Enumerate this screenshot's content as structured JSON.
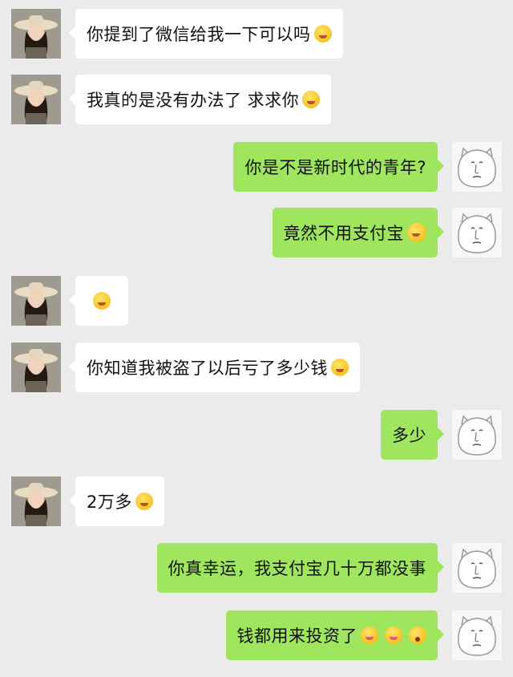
{
  "messages": [
    {
      "side": "left",
      "text": "你提到了微信给我一下可以吗",
      "emoji": "grimace-emoji"
    },
    {
      "side": "left",
      "text": "我真的是没有办法了 求求你",
      "emoji": "grimace-emoji"
    },
    {
      "side": "right",
      "text": "你是不是新时代的青年?",
      "emoji": ""
    },
    {
      "side": "right",
      "text": "竟然不用支付宝",
      "emoji": "laughing-tears-emoji"
    },
    {
      "side": "left",
      "text": "",
      "emoji": "confused-bubble-emoji"
    },
    {
      "side": "left",
      "text": "你知道我被盗了以后亏了多少钱",
      "emoji": "grimace-emoji"
    },
    {
      "side": "right",
      "text": "多少",
      "emoji": ""
    },
    {
      "side": "left",
      "text": "2万多",
      "emoji": "grimace-emoji"
    },
    {
      "side": "right",
      "text": "你真幸运，我支付宝几十万都没事",
      "emoji": ""
    },
    {
      "side": "right",
      "text": "钱都用来投资了",
      "emoji": "tongue-emoji, tongue-emoji, flushed-emoji"
    }
  ],
  "avatars": {
    "left": "woman-hat-avatar",
    "right": "cartoon-white-face-avatar"
  },
  "colors": {
    "background": "#ebebeb",
    "incoming_bubble": "#ffffff",
    "outgoing_bubble": "#9fe55d"
  }
}
